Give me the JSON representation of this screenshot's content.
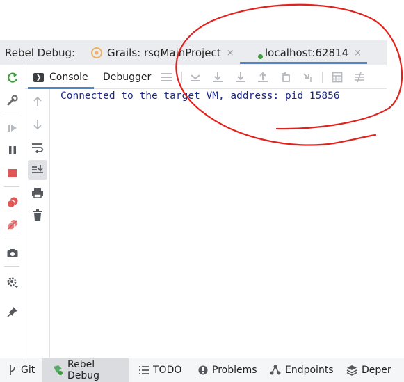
{
  "debug_bar": {
    "title": "Rebel Debug:",
    "tabs": [
      {
        "label": "Grails: rsqMainProject",
        "close": "×"
      },
      {
        "label": "localhost:62814",
        "close": "×",
        "selected": true
      }
    ]
  },
  "console_toolbar": {
    "tabs": [
      {
        "label": "Console",
        "icon_glyph": "❯",
        "selected": true
      },
      {
        "label": "Debugger"
      }
    ]
  },
  "console": {
    "output": "Connected to the target VM, address: pid 15856"
  },
  "bottom_tabs": [
    {
      "label": "Git",
      "icon": "git-branch-icon"
    },
    {
      "label": "Rebel Debug",
      "icon": "rebel-debug-icon",
      "active": true
    },
    {
      "label": "TODO",
      "icon": "list-icon"
    },
    {
      "label": "Problems",
      "icon": "problems-icon"
    },
    {
      "label": "Endpoints",
      "icon": "endpoints-icon"
    },
    {
      "label": "Deper",
      "icon": "dependencies-icon"
    }
  ],
  "colors": {
    "accent": "#4a88c7",
    "console_text": "#1c2a86",
    "run_green": "#3c9e3c",
    "stop_red": "#e05555",
    "annotation_red": "#e3211c"
  }
}
